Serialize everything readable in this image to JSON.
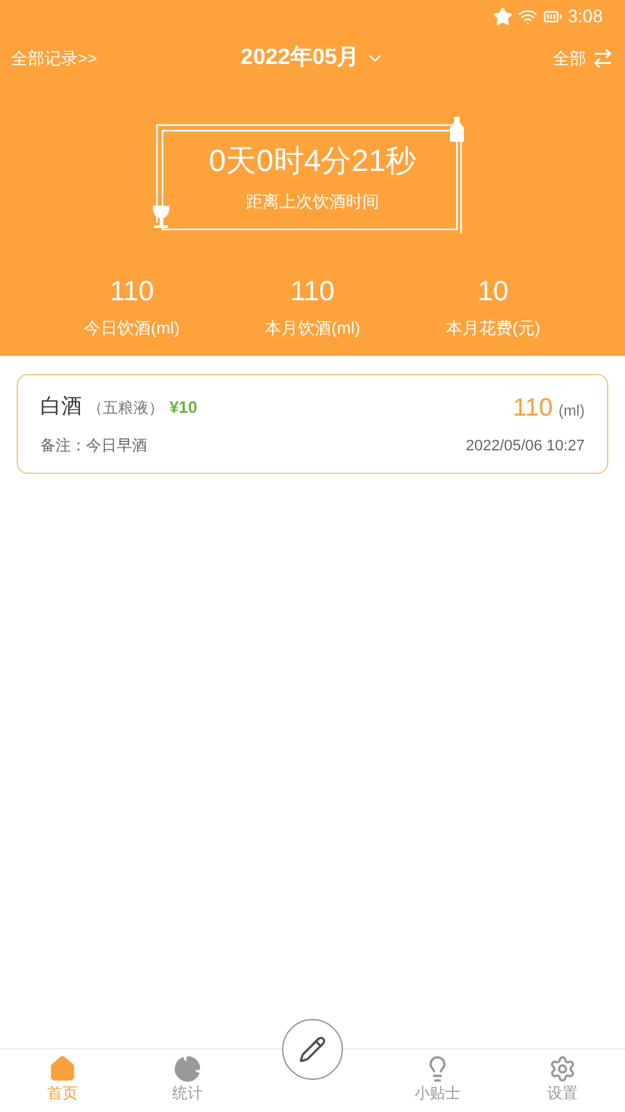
{
  "status_bar": {
    "time": "3:08"
  },
  "header": {
    "all_records": "全部记录>>",
    "month": "2022年05月",
    "filter": "全部"
  },
  "timer": {
    "elapsed": "0天0时4分21秒",
    "caption": "距离上次饮酒时间"
  },
  "stats": [
    {
      "value": "110",
      "label": "今日饮酒(ml)"
    },
    {
      "value": "110",
      "label": "本月饮酒(ml)"
    },
    {
      "value": "10",
      "label": "本月花费(元)"
    }
  ],
  "records": [
    {
      "name": "白酒",
      "brand": "（五粮液）",
      "price": "¥10",
      "amount": "110",
      "unit": "(ml)",
      "note": "备注：今日早酒",
      "time": "2022/05/06 10:27"
    }
  ],
  "tabs": [
    {
      "label": "首页",
      "kind": "home",
      "selected": true
    },
    {
      "label": "统计",
      "kind": "stats",
      "selected": false
    },
    {
      "label": "小贴士",
      "kind": "tips",
      "selected": false
    },
    {
      "label": "设置",
      "kind": "settings",
      "selected": false
    }
  ]
}
